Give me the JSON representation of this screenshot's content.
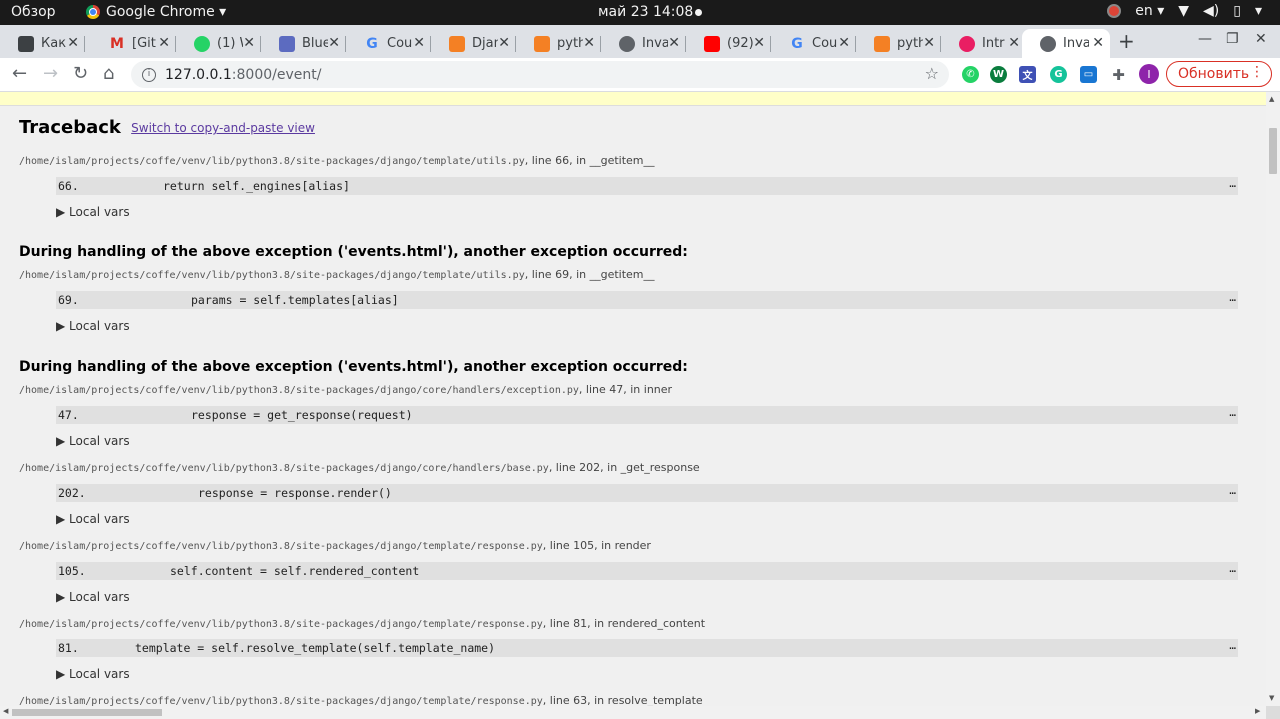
{
  "os": {
    "activities": "Обзор",
    "app_name": "Google Chrome ▾",
    "clock": "май 23  14:08",
    "lang": "en ▾",
    "icons": [
      "wifi-icon",
      "volume-icon",
      "battery-icon",
      "power-menu-icon"
    ]
  },
  "tabs": [
    {
      "title": "Как",
      "favicon": "dark-square",
      "color": "#3c4043"
    },
    {
      "title": "[Git",
      "favicon": "gmail",
      "color": "#d93025"
    },
    {
      "title": "(1) W",
      "favicon": "whatsapp",
      "color": "#25d366"
    },
    {
      "title": "Blue",
      "favicon": "blue-wave",
      "color": "#5c6bc0"
    },
    {
      "title": "Cou",
      "favicon": "google",
      "color": "#4285f4"
    },
    {
      "title": "Djan",
      "favicon": "stackoverflow",
      "color": "#f48024"
    },
    {
      "title": "pyth",
      "favicon": "stackoverflow",
      "color": "#f48024"
    },
    {
      "title": "Inva",
      "favicon": "globe",
      "color": "#5f6368"
    },
    {
      "title": "(92)",
      "favicon": "youtube",
      "color": "#ff0000"
    },
    {
      "title": "Cou",
      "favicon": "google",
      "color": "#4285f4"
    },
    {
      "title": "pyth",
      "favicon": "stackoverflow",
      "color": "#f48024"
    },
    {
      "title": "Intr",
      "favicon": "red-circle",
      "color": "#e91e63"
    },
    {
      "title": "Inva",
      "favicon": "globe",
      "color": "#5f6368",
      "active": true
    }
  ],
  "toolbar": {
    "url_host": "127.0.0.1",
    "url_rest": ":8000/event/",
    "update_label": "Обновить",
    "profile_initial": "I"
  },
  "traceback": {
    "title": "Traceback",
    "switch_link": "Switch to copy-and-paste view",
    "local_vars": "▶ Local vars",
    "exception_note": "During handling of the above exception ('events.html'), another exception occurred:",
    "frames": [
      {
        "file": "/home/islam/projects/coffe/venv/lib/python3.8/site-packages/django/template/utils.py",
        "info": ", line 66, in __getitem__",
        "num": "66.",
        "code": "return self._engines[alias]",
        "indent": 15
      },
      {
        "file": "/home/islam/projects/coffe/venv/lib/python3.8/site-packages/django/template/utils.py",
        "info": ", line 69, in __getitem__",
        "num": "69.",
        "code": "params = self.templates[alias]",
        "indent": 19
      },
      {
        "file": "/home/islam/projects/coffe/venv/lib/python3.8/site-packages/django/core/handlers/exception.py",
        "info": ", line 47, in inner",
        "num": "47.",
        "code": "response = get_response(request)",
        "indent": 19
      },
      {
        "file": "/home/islam/projects/coffe/venv/lib/python3.8/site-packages/django/core/handlers/base.py",
        "info": ", line 202, in _get_response",
        "num": "202.",
        "code": "response = response.render()",
        "indent": 20
      },
      {
        "file": "/home/islam/projects/coffe/venv/lib/python3.8/site-packages/django/template/response.py",
        "info": ", line 105, in render",
        "num": "105.",
        "code": "self.content = self.rendered_content",
        "indent": 16
      },
      {
        "file": "/home/islam/projects/coffe/venv/lib/python3.8/site-packages/django/template/response.py",
        "info": ", line 81, in rendered_content",
        "num": "81.",
        "code": "template = self.resolve_template(self.template_name)",
        "indent": 11
      },
      {
        "file": "/home/islam/projects/coffe/venv/lib/python3.8/site-packages/django/template/response.py",
        "info": ", line 63, in resolve_template",
        "num": "",
        "code": "",
        "indent": 0
      }
    ]
  }
}
